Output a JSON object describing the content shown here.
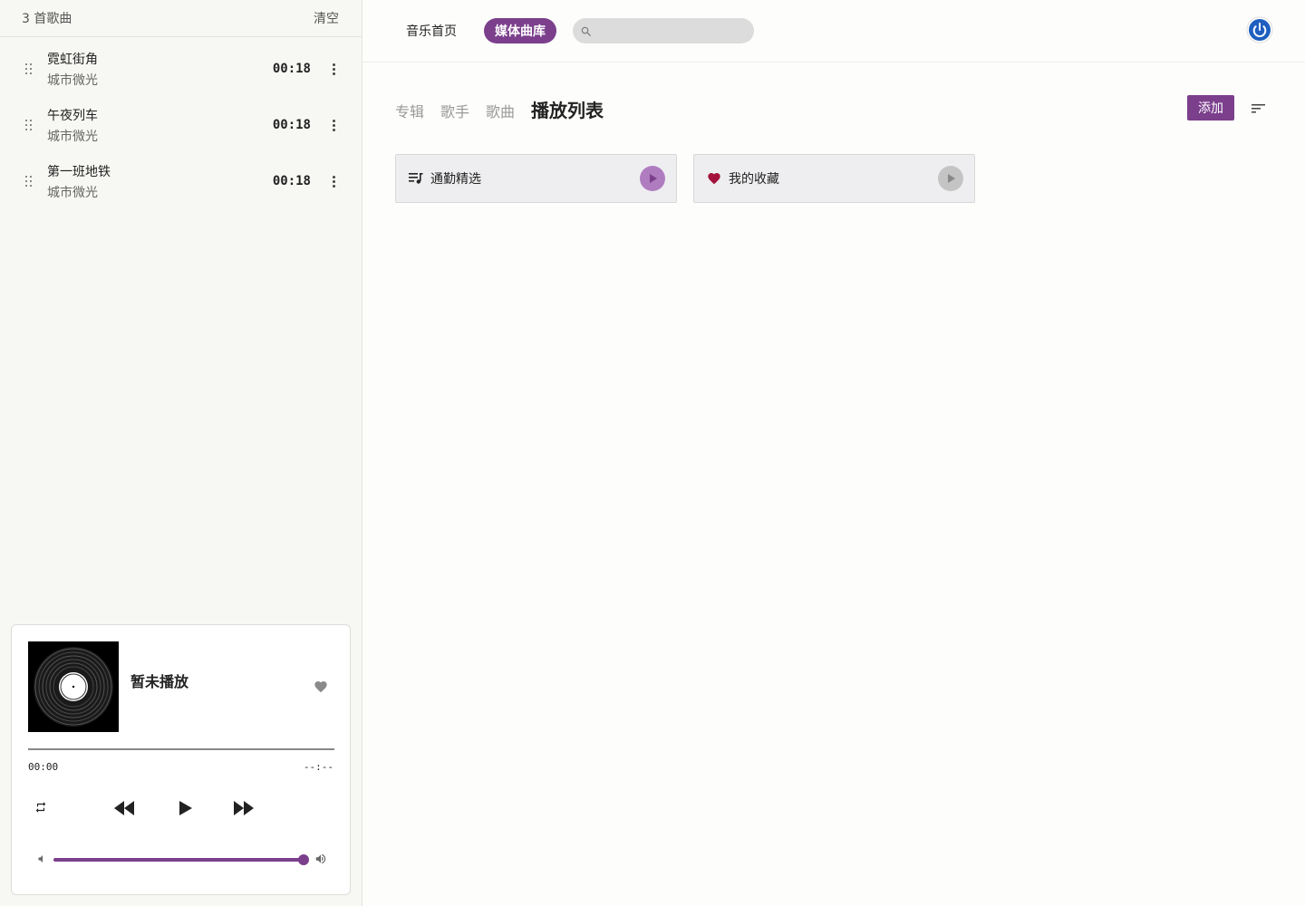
{
  "queue": {
    "count_label": "3 首歌曲",
    "clear_label": "清空",
    "tracks": [
      {
        "title": "霓虹街角",
        "artist": "城市微光",
        "duration": "00:18"
      },
      {
        "title": "午夜列车",
        "artist": "城市微光",
        "duration": "00:18"
      },
      {
        "title": "第一班地铁",
        "artist": "城市微光",
        "duration": "00:18"
      }
    ]
  },
  "player": {
    "title": "暂未播放",
    "time_current": "00:00",
    "time_total": "--:--",
    "progress": 0,
    "volume": 1.0,
    "icons": [
      "vinyl-record",
      "heart-icon",
      "repeat-icon",
      "rewind-icon",
      "play-icon",
      "fast-forward-icon",
      "volume-low-icon",
      "volume-high-icon"
    ]
  },
  "nav": {
    "home_label": "音乐首页",
    "library_label": "媒体曲库",
    "search_placeholder": ""
  },
  "library": {
    "tabs": [
      "专辑",
      "歌手",
      "歌曲",
      "播放列表"
    ],
    "active_tab": "播放列表",
    "add_label": "添加",
    "playlists": [
      {
        "name": "通勤精选",
        "icon": "playlist-icon",
        "play_color": "#b07cc0"
      },
      {
        "name": "我的收藏",
        "icon": "heart-icon",
        "play_color": "#c4c4c4"
      }
    ]
  },
  "colors": {
    "accent": "#7b3f8c",
    "favorite_heart": "#a3123a",
    "power_button": "#1f5fbf"
  }
}
